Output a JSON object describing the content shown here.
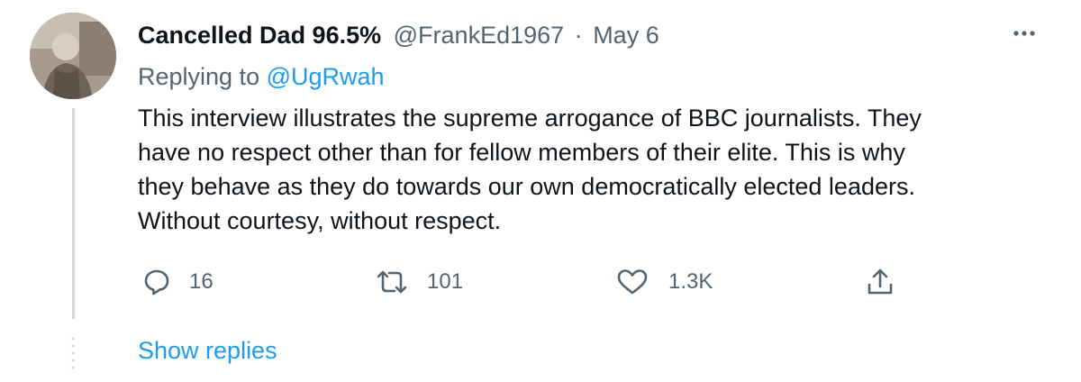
{
  "tweet": {
    "display_name": "Cancelled Dad 96.5%",
    "handle": "@FrankEd1967",
    "separator": "·",
    "date": "May 6",
    "replying_to_prefix": "Replying to",
    "replying_to_handle": "@UgRwah",
    "text_lines": [
      "This interview illustrates the supreme arrogance of BBC journalists.  They",
      "have no respect other than for fellow members of their elite.  This is why",
      "they behave as they do towards our own democratically elected leaders.",
      "Without courtesy, without respect."
    ]
  },
  "actions": {
    "reply": {
      "icon": "reply-icon",
      "count": "16"
    },
    "retweet": {
      "icon": "retweet-icon",
      "count": "101"
    },
    "like": {
      "icon": "heart-icon",
      "count": "1.3K"
    },
    "share": {
      "icon": "share-icon"
    }
  },
  "more_icon": "more-icon",
  "show_replies_label": "Show replies",
  "colors": {
    "text": "#0f1419",
    "secondary": "#536471",
    "accent": "#1d9bf0",
    "thread_line": "#cfd9de"
  }
}
